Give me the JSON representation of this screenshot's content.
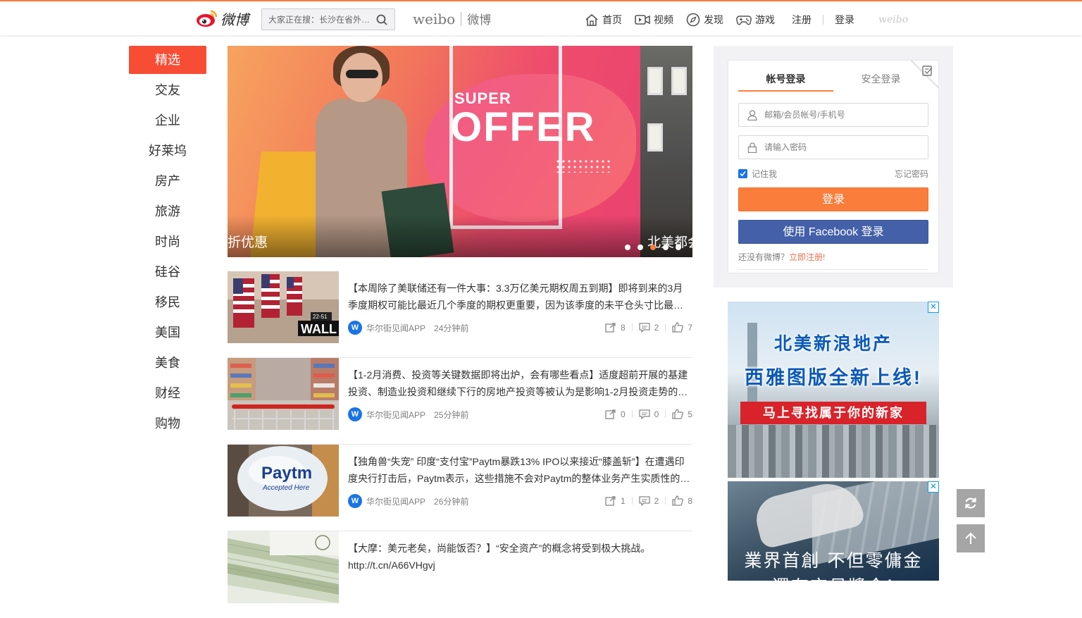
{
  "header": {
    "logo_text": "微博",
    "search_placeholder": "大家正在搜：长沙在省外…",
    "brand_en": "weibo",
    "brand_cn": "微博",
    "nav": [
      {
        "label": "首页",
        "icon": "home-icon"
      },
      {
        "label": "视频",
        "icon": "video-icon"
      },
      {
        "label": "发现",
        "icon": "compass-icon"
      },
      {
        "label": "游戏",
        "icon": "gamepad-icon"
      }
    ],
    "register": "注册",
    "login": "登录",
    "mini_logo": "weibo"
  },
  "sidebar": {
    "items": [
      "精选",
      "交友",
      "企业",
      "好莱坞",
      "房产",
      "旅游",
      "时尚",
      "硅谷",
      "移民",
      "美国",
      "美食",
      "财经",
      "购物"
    ],
    "active_index": 0
  },
  "banner": {
    "headline_small": "SUPER",
    "headline_big": "OFFER",
    "caption_left": "折优惠",
    "caption_right": "北美都会",
    "slide_count": 5,
    "active_slide": 2
  },
  "feed": [
    {
      "text": "【本周除了美联储还有一件大事：3.3万亿美元期权周五到期】即将到来的3月季度期权可能比最近几个季度的期权更重要，因为该季度的未平仓头寸比最…",
      "source": "华尔街见闻APP",
      "time": "24分钟前",
      "reposts": "8",
      "comments": "2",
      "likes": "7",
      "thumb": "wall-street-flags"
    },
    {
      "text": "【1-2月消费、投资等关键数据即将出炉，会有哪些看点】适度超前开展的基建投资、制造业投资和继续下行的房地产投资等被认为是影响1-2月投资走势的…",
      "source": "华尔街见闻APP",
      "time": "25分钟前",
      "reposts": "0",
      "comments": "0",
      "likes": "5",
      "thumb": "shopping-cart"
    },
    {
      "text": "【独角兽“失宠” 印度“支付宝”Paytm暴跌13% IPO以来接近“膝盖斩”】在遭遇印度央行打击后，Paytm表示，这些措施不会对Paytm的整体业务产生实质性的…",
      "source": "华尔街见闻APP",
      "time": "26分钟前",
      "reposts": "1",
      "comments": "2",
      "likes": "8",
      "thumb": "paytm-balloon",
      "thumb_text_1": "Paytm",
      "thumb_text_2": "Accepted Here"
    },
    {
      "text": "【大摩：美元老矣，尚能饭否？】“安全资产”的概念将受到极大挑战。http://t.cn/A66VHgvj",
      "thumb": "dollar-bills"
    }
  ],
  "login": {
    "tab_account": "帐号登录",
    "tab_secure": "安全登录",
    "username_placeholder": "邮箱/会员帐号/手机号",
    "password_placeholder": "请输入密码",
    "remember": "记住我",
    "forgot": "忘记密码",
    "login_button": "登录",
    "facebook_button": "使用 Facebook 登录",
    "no_account": "还没有微博？",
    "signup_link": "立即注册!"
  },
  "ads": [
    {
      "line1": "北美新浪地产",
      "line2": "西雅图版全新上线!",
      "ribbon": "马上寻找属于你的新家",
      "close": "✕"
    },
    {
      "line1": "業界首創  不但零傭金",
      "line2": "還有交易獎金!",
      "close": "✕"
    }
  ],
  "colors": {
    "accent": "#fa7d3c",
    "active_menu": "#f74d34",
    "facebook": "#4460a8",
    "link": "#eb7350"
  }
}
